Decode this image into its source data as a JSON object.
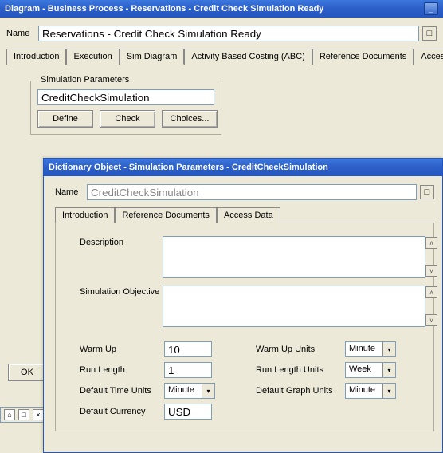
{
  "main_window": {
    "title": "Diagram - Business Process - Reservations - Credit Check Simulation Ready",
    "name_label": "Name",
    "name_value": "Reservations - Credit Check Simulation Ready",
    "tabs": [
      {
        "label": "Introduction"
      },
      {
        "label": "Execution"
      },
      {
        "label": "Sim Diagram"
      },
      {
        "label": "Activity Based Costing (ABC)"
      },
      {
        "label": "Reference Documents"
      },
      {
        "label": "Access Data"
      }
    ],
    "groupbox_title": "Simulation Parameters",
    "param_value": "CreditCheckSimulation",
    "define_btn": "Define",
    "check_btn": "Check",
    "choices_btn": "Choices...",
    "ok_btn": "OK"
  },
  "inner_window": {
    "title": "Dictionary Object - Simulation Parameters - CreditCheckSimulation",
    "name_label": "Name",
    "name_value": "CreditCheckSimulation",
    "tabs": [
      {
        "label": "Introduction"
      },
      {
        "label": "Reference Documents"
      },
      {
        "label": "Access Data"
      }
    ],
    "description_label": "Description",
    "description_value": "",
    "sim_obj_label": "Simulation Objective",
    "sim_obj_value": "",
    "fields": {
      "warm_up_label": "Warm Up",
      "warm_up_value": "10",
      "warm_up_units_label": "Warm Up Units",
      "warm_up_units_value": "Minute",
      "run_length_label": "Run Length",
      "run_length_value": "1",
      "run_length_units_label": "Run Length Units",
      "run_length_units_value": "Week",
      "default_time_units_label": "Default Time Units",
      "default_time_units_value": "Minute",
      "default_graph_units_label": "Default Graph Units",
      "default_graph_units_value": "Minute",
      "default_currency_label": "Default Currency",
      "default_currency_value": "USD"
    }
  },
  "icons": {
    "minimize": "_",
    "dropdown": "▾",
    "chevup": "ʌ",
    "chevdown": "v",
    "pin": "⌂",
    "box": "□",
    "close": "×"
  }
}
